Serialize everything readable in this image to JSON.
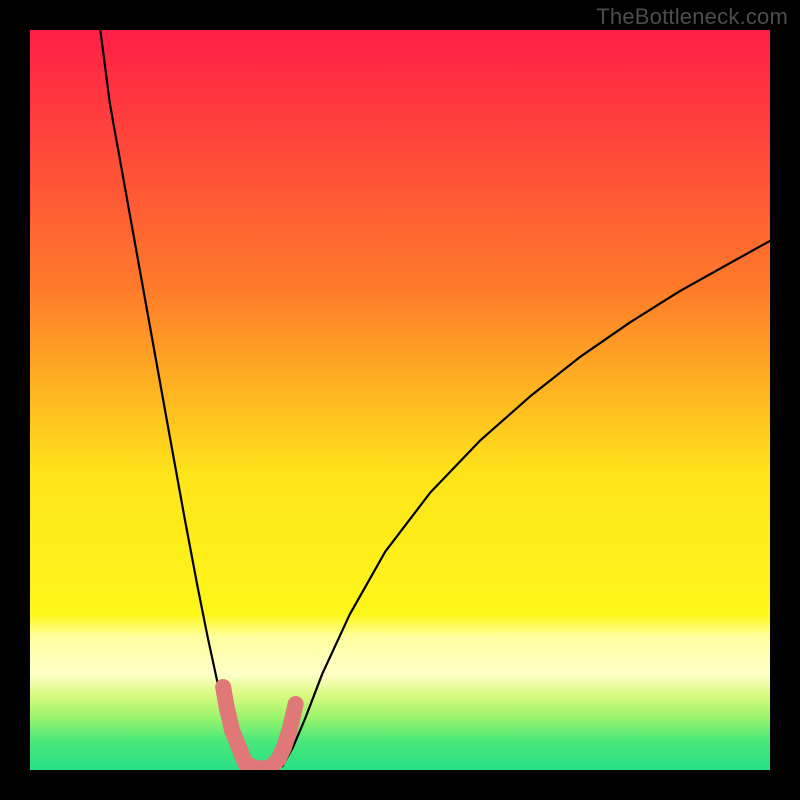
{
  "watermark": "TheBottleneck.com",
  "chart_data": {
    "type": "line",
    "title": "",
    "xlabel": "",
    "ylabel": "",
    "xlim": [
      0,
      100
    ],
    "ylim": [
      0,
      100
    ],
    "grid": false,
    "legend": false,
    "background_gradient_stops": [
      {
        "offset": 0,
        "color": "#FF1E46"
      },
      {
        "offset": 35,
        "color": "#FE7B2A"
      },
      {
        "offset": 60,
        "color": "#FEE41A"
      },
      {
        "offset": 79,
        "color": "#FEF71A"
      },
      {
        "offset": 82,
        "color": "#FFFFA0"
      },
      {
        "offset": 87,
        "color": "#FFFFC8"
      },
      {
        "offset": 90,
        "color": "#D8F97E"
      },
      {
        "offset": 93,
        "color": "#97F36B"
      },
      {
        "offset": 96,
        "color": "#4CE87A"
      },
      {
        "offset": 100,
        "color": "#27E083"
      }
    ],
    "series": [
      {
        "name": "left-branch",
        "x": [
          9.5,
          10.8,
          13.5,
          16.2,
          18.9,
          20.9,
          22.6,
          24.0,
          25.3,
          26.3,
          27.2,
          28.1,
          29.1,
          29.5
        ],
        "y": [
          100.0,
          90.0,
          75.0,
          60.0,
          45.0,
          34.0,
          25.0,
          18.0,
          12.0,
          8.5,
          5.5,
          3.0,
          1.0,
          0.5
        ]
      },
      {
        "name": "right-branch",
        "x": [
          34.1,
          35.5,
          37.2,
          39.5,
          43.2,
          48.0,
          54.1,
          60.8,
          67.6,
          74.3,
          81.1,
          87.8,
          94.6,
          100.0
        ],
        "y": [
          0.5,
          3.0,
          7.0,
          13.0,
          21.0,
          29.5,
          37.5,
          44.5,
          50.5,
          55.8,
          60.5,
          64.7,
          68.5,
          71.5
        ]
      },
      {
        "name": "valley-markers",
        "type": "scatter",
        "points": [
          {
            "x": 26.1,
            "y": 11.2
          },
          {
            "x": 26.6,
            "y": 8.4
          },
          {
            "x": 27.3,
            "y": 5.4
          },
          {
            "x": 29.1,
            "y": 0.9
          },
          {
            "x": 30.6,
            "y": 0.2
          },
          {
            "x": 31.6,
            "y": 0.2
          },
          {
            "x": 32.7,
            "y": 0.5
          },
          {
            "x": 33.6,
            "y": 1.5
          },
          {
            "x": 34.3,
            "y": 3.0
          },
          {
            "x": 35.1,
            "y": 5.5
          },
          {
            "x": 35.9,
            "y": 8.9
          }
        ],
        "color": "#E07878",
        "radius_px": 8
      }
    ]
  }
}
